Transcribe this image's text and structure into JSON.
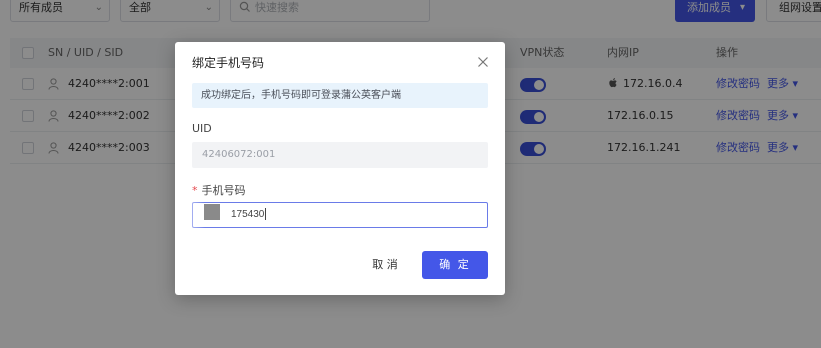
{
  "toolbar": {
    "filter_members": "所有成员",
    "filter_all": "全部",
    "search_placeholder": "快速搜索",
    "add_member_label": "添加成员",
    "network_settings_label": "组网设置"
  },
  "table": {
    "headers": {
      "id": "SN / UID / SID",
      "vpn": "VPN状态",
      "intranet_ip": "内网IP",
      "actions": "操作"
    },
    "rows": [
      {
        "id": "4240****2:001",
        "ip": "172.16.0.4",
        "has_apple": true,
        "edit": "修改密码",
        "more": "更多"
      },
      {
        "id": "4240****2:002",
        "ip": "172.16.0.15",
        "has_apple": false,
        "edit": "修改密码",
        "more": "更多"
      },
      {
        "id": "4240****2:003",
        "ip": "172.16.1.241",
        "has_apple": false,
        "edit": "修改密码",
        "more": "更多"
      }
    ]
  },
  "dialog": {
    "title": "绑定手机号码",
    "info": "成功绑定后，手机号码即可登录蒲公英客户端",
    "uid_label": "UID",
    "uid_value": "42406072:001",
    "phone_required": "*",
    "phone_label": "手机号码",
    "phone_value": "175430",
    "cancel_label": "取 消",
    "confirm_label": "确 定"
  },
  "colors": {
    "primary": "#4457e8",
    "info_bg": "#e8f3fc",
    "required": "#e5484d"
  },
  "icons": {
    "close": "close-icon",
    "search": "search-icon",
    "user": "user-icon",
    "apple": "apple-icon",
    "chevron": "chevron-down-icon"
  }
}
